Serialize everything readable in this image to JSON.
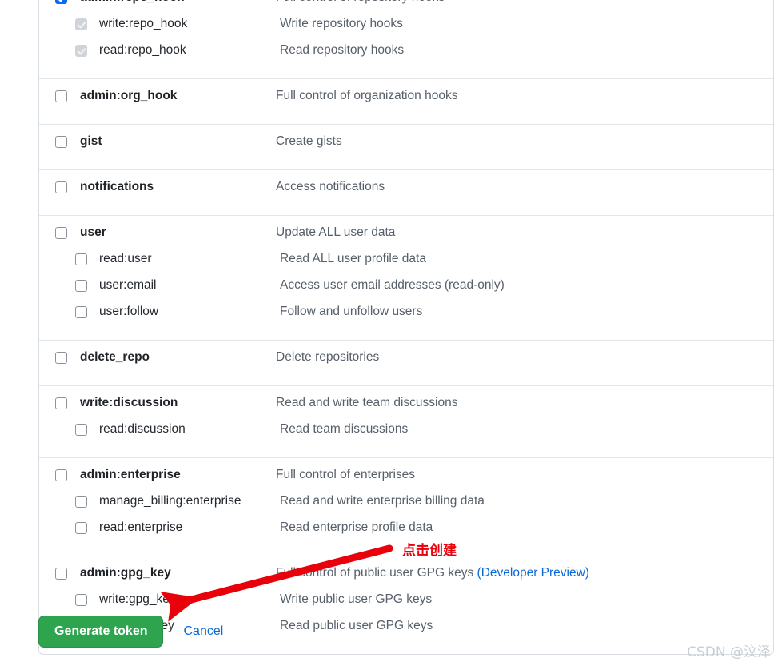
{
  "scopes": {
    "groups": [
      {
        "rows": [
          {
            "name": "admin:repo_hook",
            "desc": "Full control of repository hooks",
            "level": "parent",
            "state": "checked"
          },
          {
            "name": "write:repo_hook",
            "desc": "Write repository hooks",
            "level": "child",
            "state": "disabled-checked"
          },
          {
            "name": "read:repo_hook",
            "desc": "Read repository hooks",
            "level": "child",
            "state": "disabled-checked"
          }
        ]
      },
      {
        "rows": [
          {
            "name": "admin:org_hook",
            "desc": "Full control of organization hooks",
            "level": "parent",
            "state": "unchecked"
          }
        ]
      },
      {
        "rows": [
          {
            "name": "gist",
            "desc": "Create gists",
            "level": "parent",
            "state": "unchecked"
          }
        ]
      },
      {
        "rows": [
          {
            "name": "notifications",
            "desc": "Access notifications",
            "level": "parent",
            "state": "unchecked"
          }
        ]
      },
      {
        "rows": [
          {
            "name": "user",
            "desc": "Update ALL user data",
            "level": "parent",
            "state": "unchecked"
          },
          {
            "name": "read:user",
            "desc": "Read ALL user profile data",
            "level": "child",
            "state": "unchecked"
          },
          {
            "name": "user:email",
            "desc": "Access user email addresses (read-only)",
            "level": "child",
            "state": "unchecked"
          },
          {
            "name": "user:follow",
            "desc": "Follow and unfollow users",
            "level": "child",
            "state": "unchecked"
          }
        ]
      },
      {
        "rows": [
          {
            "name": "delete_repo",
            "desc": "Delete repositories",
            "level": "parent",
            "state": "unchecked"
          }
        ]
      },
      {
        "rows": [
          {
            "name": "write:discussion",
            "desc": "Read and write team discussions",
            "level": "parent",
            "state": "unchecked"
          },
          {
            "name": "read:discussion",
            "desc": "Read team discussions",
            "level": "child",
            "state": "unchecked"
          }
        ]
      },
      {
        "rows": [
          {
            "name": "admin:enterprise",
            "desc": "Full control of enterprises",
            "level": "parent",
            "state": "unchecked"
          },
          {
            "name": "manage_billing:enterprise",
            "desc": "Read and write enterprise billing data",
            "level": "child",
            "state": "unchecked"
          },
          {
            "name": "read:enterprise",
            "desc": "Read enterprise profile data",
            "level": "child",
            "state": "unchecked"
          }
        ]
      },
      {
        "rows": [
          {
            "name": "admin:gpg_key",
            "desc": "Full control of public user GPG keys ",
            "desc_link": "(Developer Preview)",
            "level": "parent",
            "state": "unchecked"
          },
          {
            "name": "write:gpg_key",
            "desc": "Write public user GPG keys",
            "level": "child",
            "state": "unchecked"
          },
          {
            "name": "read:gpg_key",
            "desc": "Read public user GPG keys",
            "level": "child",
            "state": "unchecked"
          }
        ]
      }
    ]
  },
  "actions": {
    "generate_label": "Generate token",
    "cancel_label": "Cancel",
    "generate_color": "#2ea44f",
    "cancel_color": "#0969da"
  },
  "annotation": {
    "text": "点击创建",
    "color": "#e8000b"
  },
  "watermark": {
    "text": "CSDN @汶泽",
    "color": "#c9ced4"
  }
}
